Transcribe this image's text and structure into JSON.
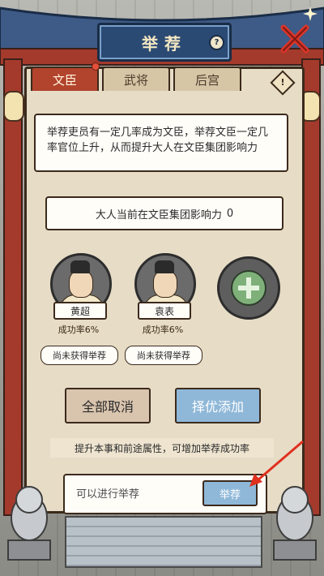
{
  "title": "举荐",
  "help_icon": "?",
  "info_icon": "!",
  "tabs": [
    {
      "label": "文臣",
      "active": true
    },
    {
      "label": "武将",
      "active": false
    },
    {
      "label": "后宫",
      "active": false
    }
  ],
  "description": "举荐吏员有一定几率成为文臣，举荐文臣一定几率官位上升，从而提升大人在文臣集团影响力",
  "influence": {
    "label": "大人当前在文臣集团影响力",
    "value": "0"
  },
  "candidates": [
    {
      "name": "黄超",
      "rate": "成功率6%",
      "status": "尚未获得举荐"
    },
    {
      "name": "袁表",
      "rate": "成功率6%",
      "status": "尚未获得举荐"
    }
  ],
  "buttons": {
    "cancel_all": "全部取消",
    "auto_add": "择优添加",
    "recommend": "举荐"
  },
  "tip": "提升本事和前途属性，可增加举荐成功率",
  "action": {
    "status": "可以进行举荐"
  },
  "colors": {
    "accent_red": "#b2432d",
    "plaque_blue": "#2b4a73",
    "button_blue": "#8fb8d8",
    "arrow_red": "#e0301e"
  }
}
